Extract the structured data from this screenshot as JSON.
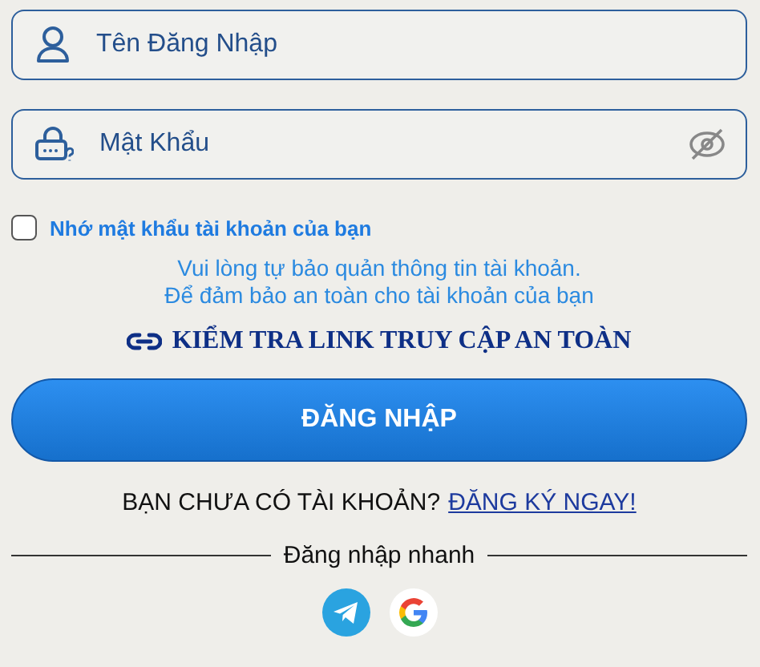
{
  "username_field": {
    "placeholder": "Tên Đăng Nhập"
  },
  "password_field": {
    "placeholder": "Mật Khẩu"
  },
  "remember": {
    "label": "Nhớ mật khẩu tài khoản của bạn",
    "checked": false
  },
  "notice": [
    "Vui lòng tự bảo quản thông tin tài khoản.",
    "Để đảm bảo an toàn cho tài khoản của bạn"
  ],
  "safe_link": "KIỂM TRA LINK TRUY CẬP AN TOÀN",
  "login_button": "ĐĂNG NHẬP",
  "register": {
    "question": "BẠN CHƯA CÓ TÀI KHOẢN?",
    "link": "ĐĂNG KÝ NGAY!"
  },
  "quick_login": {
    "label": "Đăng nhập nhanh",
    "providers": [
      {
        "kind": "telegram"
      },
      {
        "kind": "google"
      }
    ]
  }
}
